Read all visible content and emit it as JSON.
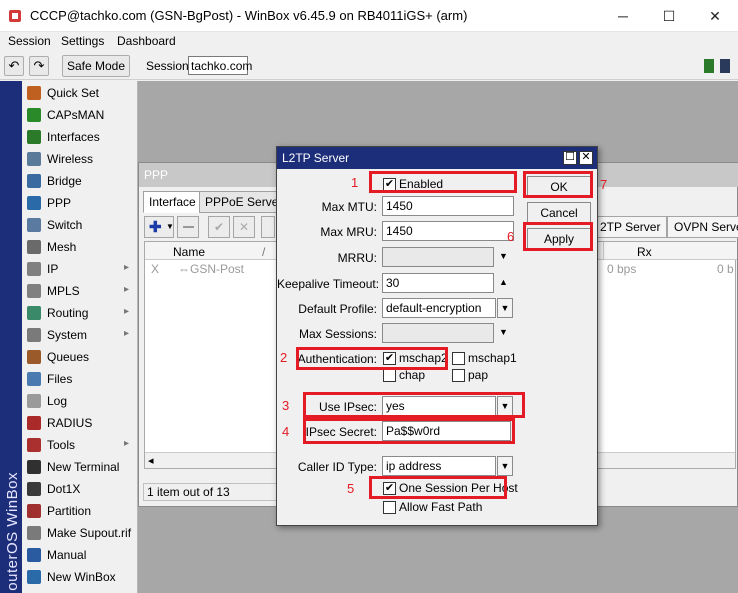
{
  "window": {
    "title": "CCCP@tachko.com (GSN-BgPost) - WinBox v6.45.9 on RB4011iGS+ (arm)",
    "minimize": "─",
    "maximize": "☐",
    "close": "✕"
  },
  "menu": {
    "session": "Session",
    "settings": "Settings",
    "dashboard": "Dashboard"
  },
  "toolbar": {
    "undo": "↶",
    "redo": "↷",
    "safe_mode": "Safe Mode",
    "session_label": "Session:",
    "session_value": "tachko.com"
  },
  "sidebar": {
    "brand": "outerOS WinBox",
    "items": [
      {
        "label": "Quick Set",
        "color": "#c06020"
      },
      {
        "label": "CAPsMAN",
        "color": "#2a8a2a"
      },
      {
        "label": "Interfaces",
        "color": "#2a7a2a"
      },
      {
        "label": "Wireless",
        "color": "#5a7a9a"
      },
      {
        "label": "Bridge",
        "color": "#3a6aa0"
      },
      {
        "label": "PPP",
        "color": "#2a6aa8"
      },
      {
        "label": "Switch",
        "color": "#5a7aa0"
      },
      {
        "label": "Mesh",
        "color": "#6a6a6a"
      },
      {
        "label": "IP",
        "color": "#808080",
        "arrow": "▸"
      },
      {
        "label": "MPLS",
        "color": "#808080",
        "arrow": "▸"
      },
      {
        "label": "Routing",
        "color": "#3a8a6a",
        "arrow": "▸"
      },
      {
        "label": "System",
        "color": "#7a7a7a",
        "arrow": "▸"
      },
      {
        "label": "Queues",
        "color": "#9a5a2a"
      },
      {
        "label": "Files",
        "color": "#4a7ab0"
      },
      {
        "label": "Log",
        "color": "#9a9a9a"
      },
      {
        "label": "RADIUS",
        "color": "#aa2a2a"
      },
      {
        "label": "Tools",
        "color": "#aa3030",
        "arrow": "▸"
      },
      {
        "label": "New Terminal",
        "color": "#303030"
      },
      {
        "label": "Dot1X",
        "color": "#3a3a3a"
      },
      {
        "label": "Partition",
        "color": "#a03030"
      },
      {
        "label": "Make Supout.rif",
        "color": "#7a7a7a"
      },
      {
        "label": "Manual",
        "color": "#2a5aa0"
      },
      {
        "label": "New WinBox",
        "color": "#2a6aa8"
      }
    ]
  },
  "ppp": {
    "title": "PPP",
    "tabs": [
      "Interface",
      "PPPoE Servers"
    ],
    "right_tabs": [
      "2TP Server",
      "OVPN Server"
    ],
    "col_name": "Name",
    "col_sort": "/",
    "col_rx": "Rx",
    "row_flag": "X",
    "row_name": "⇔GSN-Post",
    "row_bps": "0 bps",
    "row_b": "0 b",
    "status": "1 item out of 13",
    "scroll_left": "◂"
  },
  "dialog": {
    "title": "L2TP Server",
    "enabled_label": "Enabled",
    "max_mtu_label": "Max MTU:",
    "max_mtu": "1450",
    "max_mru_label": "Max MRU:",
    "max_mru": "1450",
    "mrru_label": "MRRU:",
    "keepalive_label": "Keepalive Timeout:",
    "keepalive": "30",
    "default_profile_label": "Default Profile:",
    "default_profile": "default-encryption",
    "max_sessions_label": "Max Sessions:",
    "auth_label": "Authentication:",
    "auth_mschap2": "mschap2",
    "auth_mschap1": "mschap1",
    "auth_chap": "chap",
    "auth_pap": "pap",
    "use_ipsec_label": "Use IPsec:",
    "use_ipsec": "yes",
    "ipsec_secret_label": "IPsec Secret:",
    "ipsec_secret": "Pa$$w0rd",
    "caller_id_label": "Caller ID Type:",
    "caller_id": "ip address",
    "one_session_label": "One Session Per Host",
    "allow_fast_path_label": "Allow Fast Path",
    "ok": "OK",
    "cancel": "Cancel",
    "apply": "Apply",
    "check": "✔"
  },
  "annotations": [
    "1",
    "2",
    "3",
    "4",
    "5",
    "6",
    "7"
  ],
  "colors": {
    "accent_red": "#e41b24",
    "title_blue": "#1c2d7a"
  }
}
